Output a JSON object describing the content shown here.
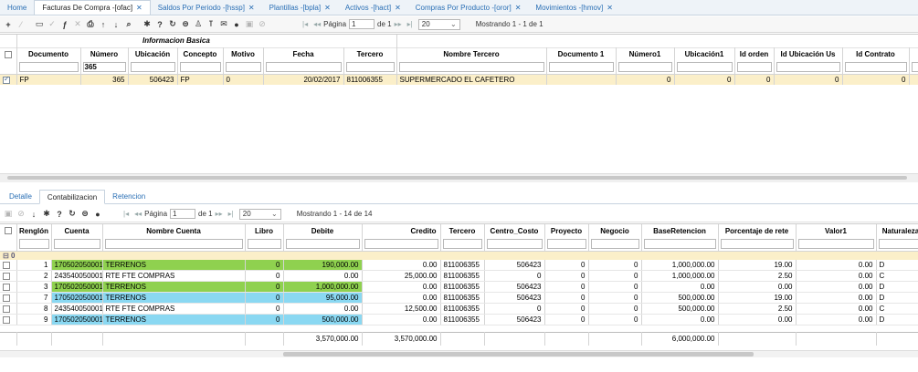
{
  "tabs": [
    {
      "label": "Home",
      "closable": false,
      "active": false
    },
    {
      "label": "Facturas De Compra -[ofac]",
      "closable": true,
      "active": true
    },
    {
      "label": "Saldos Por Periodo -[hssp]",
      "closable": true,
      "active": false
    },
    {
      "label": "Plantillas -[bpla]",
      "closable": true,
      "active": false
    },
    {
      "label": "Activos -[hact]",
      "closable": true,
      "active": false
    },
    {
      "label": "Compras Por Producto -[oror]",
      "closable": true,
      "active": false
    },
    {
      "label": "Movimientos -[hmov]",
      "closable": true,
      "active": false
    }
  ],
  "toolbar": {
    "page_label": "Página",
    "page_value": "1",
    "page_of": "de 1",
    "page_size": "20",
    "status": "Mostrando 1 - 1 de 1"
  },
  "top_grid": {
    "group_header": "Informacion Basica",
    "columns": [
      "Documento",
      "Número",
      "Ubicación",
      "Concepto",
      "Motivo",
      "Fecha",
      "Tercero",
      "Nombre Tercero",
      "Documento 1",
      "Número1",
      "Ubicación1",
      "Id orden",
      "Id Ubicación Us",
      "Id Contrato"
    ],
    "filter_numero": "365",
    "rows": [
      {
        "documento": "FP",
        "numero": "365",
        "ubicacion": "506423",
        "concepto": "FP",
        "motivo": "0",
        "fecha": "20/02/2017",
        "tercero": "811006355",
        "nombre_tercero": "SUPERMERCADO EL CAFETERO",
        "documento1": "",
        "numero1": "0",
        "ubicacion1": "0",
        "id_orden": "0",
        "id_ubicacion_us": "0",
        "id_contrato": "0"
      }
    ]
  },
  "subtabs": [
    "Detalle",
    "Contabilizacion",
    "Retencion"
  ],
  "bottom_toolbar": {
    "page_label": "Página",
    "page_value": "1",
    "page_of": "de 1",
    "page_size": "20",
    "status": "Mostrando 1 - 14 de 14"
  },
  "bottom_grid": {
    "columns": [
      "Renglón",
      "Cuenta",
      "Nombre Cuenta",
      "Libro",
      "Debite",
      "Credito",
      "Tercero",
      "Centro_Costo",
      "Proyecto",
      "Negocio",
      "BaseRetencion",
      "Porcentaje de rete",
      "Valor1",
      "Naturaleza"
    ],
    "group_label": "0",
    "rows": [
      {
        "renglon": "1",
        "cuenta": "170502050001",
        "nombre": "TERRENOS",
        "libro": "0",
        "debite": "190,000.00",
        "credito": "0.00",
        "tercero": "811006355",
        "centro": "506423",
        "proyecto": "0",
        "negocio": "0",
        "base": "1,000,000.00",
        "porcentaje": "19.00",
        "valor1": "0.00",
        "nat": "D",
        "hl": "green"
      },
      {
        "renglon": "2",
        "cuenta": "243540050001",
        "nombre": "RTE FTE COMPRAS",
        "libro": "0",
        "debite": "0.00",
        "credito": "25,000.00",
        "tercero": "811006355",
        "centro": "0",
        "proyecto": "0",
        "negocio": "0",
        "base": "1,000,000.00",
        "porcentaje": "2.50",
        "valor1": "0.00",
        "nat": "C",
        "hl": ""
      },
      {
        "renglon": "3",
        "cuenta": "170502050001",
        "nombre": "TERRENOS",
        "libro": "0",
        "debite": "1,000,000.00",
        "credito": "0.00",
        "tercero": "811006355",
        "centro": "506423",
        "proyecto": "0",
        "negocio": "0",
        "base": "0.00",
        "porcentaje": "0.00",
        "valor1": "0.00",
        "nat": "D",
        "hl": "green"
      },
      {
        "renglon": "7",
        "cuenta": "170502050001",
        "nombre": "TERRENOS",
        "libro": "0",
        "debite": "95,000.00",
        "credito": "0.00",
        "tercero": "811006355",
        "centro": "506423",
        "proyecto": "0",
        "negocio": "0",
        "base": "500,000.00",
        "porcentaje": "19.00",
        "valor1": "0.00",
        "nat": "D",
        "hl": "blue"
      },
      {
        "renglon": "8",
        "cuenta": "243540050001",
        "nombre": "RTE FTE COMPRAS",
        "libro": "0",
        "debite": "0.00",
        "credito": "12,500.00",
        "tercero": "811006355",
        "centro": "0",
        "proyecto": "0",
        "negocio": "0",
        "base": "500,000.00",
        "porcentaje": "2.50",
        "valor1": "0.00",
        "nat": "C",
        "hl": ""
      },
      {
        "renglon": "9",
        "cuenta": "170502050001",
        "nombre": "TERRENOS",
        "libro": "0",
        "debite": "500,000.00",
        "credito": "0.00",
        "tercero": "811006355",
        "centro": "506423",
        "proyecto": "0",
        "negocio": "0",
        "base": "0.00",
        "porcentaje": "0.00",
        "valor1": "0.00",
        "nat": "D",
        "hl": "blue"
      }
    ],
    "totals": {
      "debite": "3,570,000.00",
      "credito": "3,570,000.00",
      "base": "6,000,000.00"
    }
  },
  "colors": {
    "selected_row": "#fbefc9",
    "highlight_green": "#8fd14f",
    "highlight_blue": "#8ad8f2",
    "link": "#2a6fb5"
  }
}
